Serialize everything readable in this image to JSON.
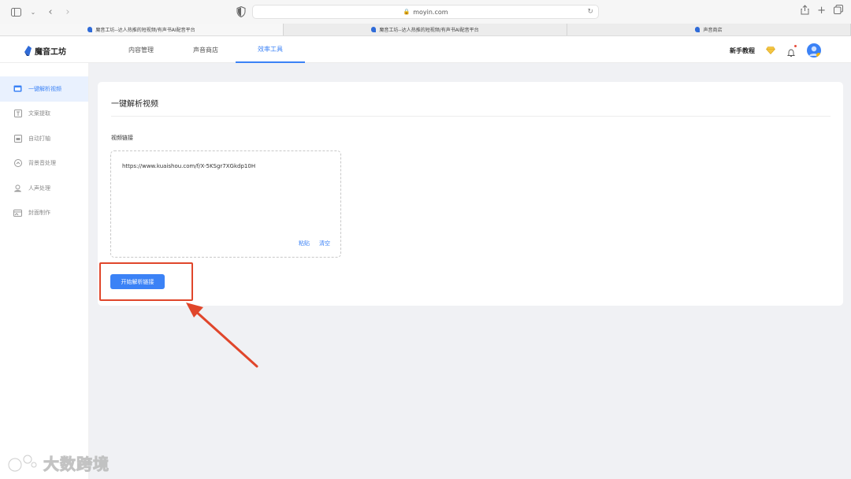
{
  "browser": {
    "url": "moyin.com",
    "tabs": [
      {
        "title": "魔音工坊--达人热推的短视频/有声书AI配音平台",
        "active": true
      },
      {
        "title": "魔音工坊--达人热推的短视频/有声书AI配音平台",
        "active": false
      },
      {
        "title": "声音商店",
        "active": false
      }
    ]
  },
  "header": {
    "logo_text": "魔音工坊",
    "nav": [
      {
        "label": "内容管理",
        "active": false
      },
      {
        "label": "声音商店",
        "active": false
      },
      {
        "label": "效率工具",
        "active": true
      }
    ],
    "tutorial_label": "新手教程"
  },
  "sidebar": {
    "items": [
      {
        "label": "一键解析视频",
        "icon": "video-parse-icon",
        "active": true
      },
      {
        "label": "文案提取",
        "icon": "text-extract-icon",
        "active": false
      },
      {
        "label": "自动打轴",
        "icon": "auto-timeline-icon",
        "active": false
      },
      {
        "label": "背景音处理",
        "icon": "background-audio-icon",
        "active": false
      },
      {
        "label": "人声处理",
        "icon": "voice-process-icon",
        "active": false
      },
      {
        "label": "封面制作",
        "icon": "cover-make-icon",
        "active": false
      }
    ]
  },
  "main": {
    "card_title": "一键解析视频",
    "field_label": "视频链接",
    "url_value": "https://www.kuaishou.com/f/X-5KSgr7XGkdp10H",
    "paste_label": "粘贴",
    "clear_label": "清空",
    "parse_button_label": "开始解析链接"
  },
  "watermark": {
    "text": "大数跨境"
  },
  "colors": {
    "accent": "#3b82f6",
    "annotation": "#e0462b",
    "background": "#f0f1f4"
  }
}
